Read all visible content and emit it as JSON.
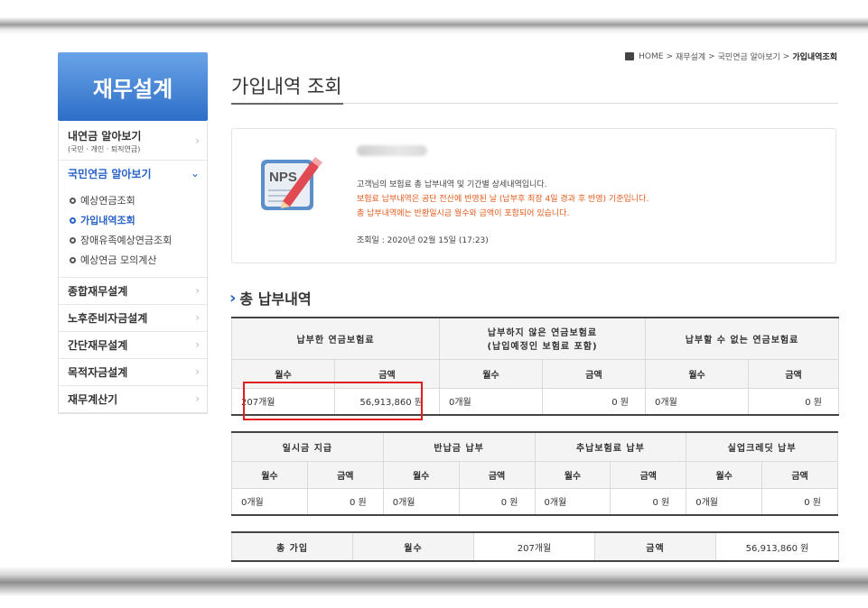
{
  "breadcrumb": {
    "home": "HOME",
    "sep": ">",
    "level1": "재무설계",
    "level2": "국민연금 알아보기",
    "current": "가입내역조회"
  },
  "nav": {
    "header": "재무설계",
    "items": [
      {
        "label": "내연금 알아보기",
        "sub": "(국민 · 개인 · 퇴직연금)"
      },
      {
        "label": "국민연금 알아보기",
        "active": true
      }
    ],
    "subitems": [
      "예상연금조회",
      "가입내역조회",
      "장애유족예상연금조회",
      "예상연금 모의계산"
    ],
    "more_items": [
      "종합재무설계",
      "노후준비자금설계",
      "간단재무설계",
      "목적자금설계",
      "재무계산기"
    ]
  },
  "page": {
    "title": "가입내역 조회"
  },
  "info": {
    "icon_text": "NPS",
    "line1": "고객님의 보험료 총 납부내역 및 기간별 상세내역입니다.",
    "line2": "보험료 납부내역은 공단 전산에 반영된 날 (납부후 최장 4일 경과 후 반영) 기준입니다.",
    "line3": "총 납부내역에는 반환일시금 월수와 금액이 포함되어 있습니다.",
    "line4": "조회일 : 2020년 02월 15일 (17:23)"
  },
  "section": {
    "title": "총 납부내역"
  },
  "table1": {
    "headers": [
      "납부한 연금보험료",
      "납부하지 않은 연금보험료",
      "(납입예정인 보험료 포함)",
      "납부할 수 없는 연금보험료"
    ],
    "sub": [
      "월수",
      "금액",
      "월수",
      "금액",
      "월수",
      "금액"
    ],
    "values": [
      "207개월",
      "56,913,860 원",
      "0개월",
      "0 원",
      "0개월",
      "0 원"
    ]
  },
  "table2": {
    "headers": [
      "일시금 지급",
      "반납금 납부",
      "추납보험료 납부",
      "실업크레딧 납부"
    ],
    "sub": [
      "월수",
      "금액",
      "월수",
      "금액",
      "월수",
      "금액",
      "월수",
      "금액"
    ],
    "values": [
      "0개월",
      "0 원",
      "0개월",
      "0 원",
      "0개월",
      "0 원",
      "0개월",
      "0 원"
    ]
  },
  "table3": {
    "label": "총 가입",
    "months_label": "월수",
    "months": "207개월",
    "amount_label": "금액",
    "amount": "56,913,860 원"
  },
  "colors": {
    "accent": "#2962c9",
    "notice": "#e55a1b",
    "highlight": "#e21d22"
  }
}
